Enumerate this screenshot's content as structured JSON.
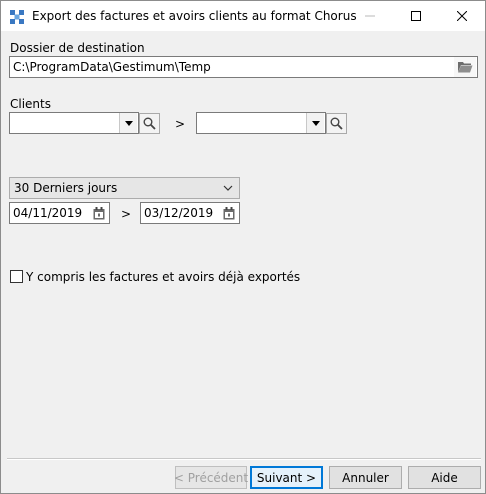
{
  "window": {
    "title": "Export des factures et avoirs clients au format Chorus"
  },
  "destination": {
    "label": "Dossier de destination",
    "path": "C:\\ProgramData\\Gestimum\\Temp"
  },
  "clients": {
    "label": "Clients",
    "from_value": "",
    "to_value": "",
    "separator": ">"
  },
  "period": {
    "selected": "30 Derniers jours",
    "start_date": "04/11/2019",
    "end_date": "03/12/2019",
    "separator": ">"
  },
  "options": {
    "include_exported_label": "Y compris les factures et avoirs déjà exportés",
    "include_exported_checked": false
  },
  "footer": {
    "previous_label": "< Précédent",
    "next_label": "Suivant >",
    "cancel_label": "Annuler",
    "help_label": "Aide"
  }
}
